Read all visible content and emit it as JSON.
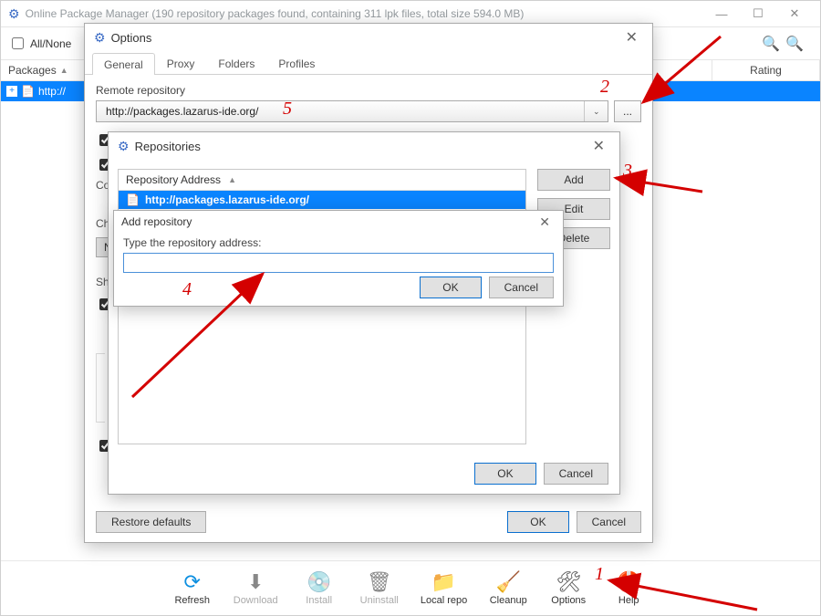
{
  "main": {
    "title": "Online Package Manager (190 repository packages found, containing 311 lpk files, total size 594.0 MB)",
    "all_none": "All/None",
    "columns": {
      "packages": "Packages",
      "rating": "Rating"
    },
    "tree_row_label": "http://",
    "toolbar": {
      "refresh": "Refresh",
      "download": "Download",
      "install": "Install",
      "uninstall": "Uninstall",
      "local_repo": "Local repo",
      "cleanup": "Cleanup",
      "options": "Options",
      "help": "Help"
    }
  },
  "options": {
    "title": "Options",
    "tabs": {
      "general": "General",
      "proxy": "Proxy",
      "folders": "Folders",
      "profiles": "Profiles"
    },
    "remote_label": "Remote repository",
    "remote_value": "http://packages.lazarus-ide.org/",
    "browse": "...",
    "restore": "Restore defaults",
    "ok": "OK",
    "cancel": "Cancel",
    "checks": {
      "c3_prefix": "Co",
      "c4_prefix": "Ch",
      "c4_btn": "N",
      "c5_prefix": "Sh"
    }
  },
  "repos": {
    "title": "Repositories",
    "header": "Repository Address",
    "row0": "http://packages.lazarus-ide.org/",
    "btn_add": "Add",
    "btn_edit": "Edit",
    "btn_delete": "Delete",
    "ok": "OK",
    "cancel": "Cancel"
  },
  "addrepo": {
    "title": "Add repository",
    "label": "Type the repository address:",
    "ok": "OK",
    "cancel": "Cancel"
  },
  "annotations": {
    "n1": "1",
    "n2": "2",
    "n3": "3",
    "n4": "4",
    "n5": "5"
  }
}
